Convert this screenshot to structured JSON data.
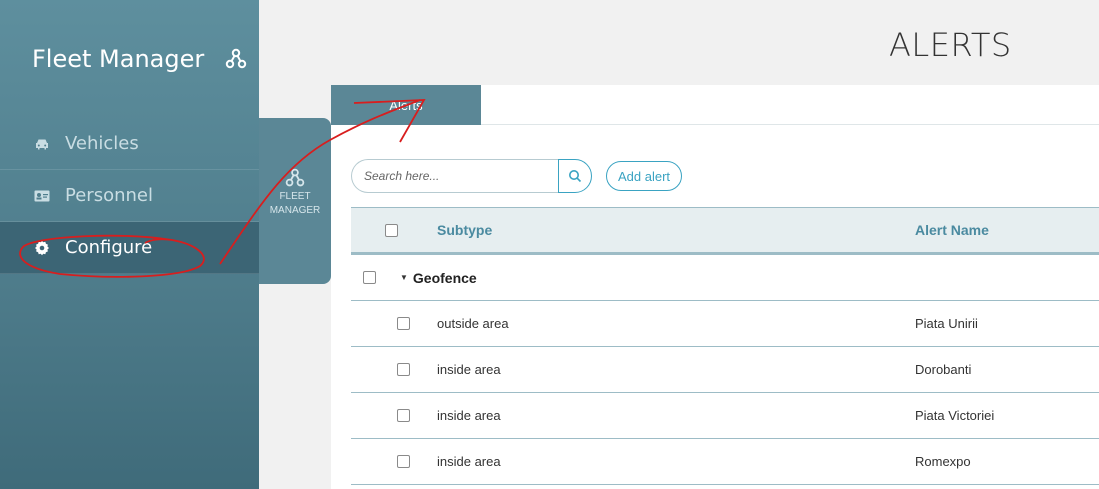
{
  "app": {
    "title": "Fleet Manager"
  },
  "sidebar": {
    "items": [
      {
        "label": "Vehicles",
        "icon": "car-icon"
      },
      {
        "label": "Personnel",
        "icon": "id-card-icon"
      },
      {
        "label": "Configure",
        "icon": "gear-icon",
        "active": true
      }
    ]
  },
  "flyout": {
    "line1": "FLEET",
    "line2": "MANAGER",
    "icon": "network-icon"
  },
  "page": {
    "title": "ALERTS"
  },
  "tabs": [
    {
      "label": "Alerts",
      "active": true
    }
  ],
  "toolbar": {
    "search_placeholder": "Search here...",
    "add_label": "Add alert"
  },
  "table": {
    "headers": {
      "subtype": "Subtype",
      "name": "Alert Name"
    },
    "group": {
      "label": "Geofence"
    },
    "rows": [
      {
        "subtype": "outside area",
        "name": "Piata Unirii"
      },
      {
        "subtype": "inside area",
        "name": "Dorobanti"
      },
      {
        "subtype": "inside area",
        "name": "Piata Victoriei"
      },
      {
        "subtype": "inside area",
        "name": "Romexpo"
      }
    ]
  },
  "colors": {
    "sidebar": "#4f7d8c",
    "accent": "#3aa3c2",
    "annotation": "#d81e1e"
  }
}
